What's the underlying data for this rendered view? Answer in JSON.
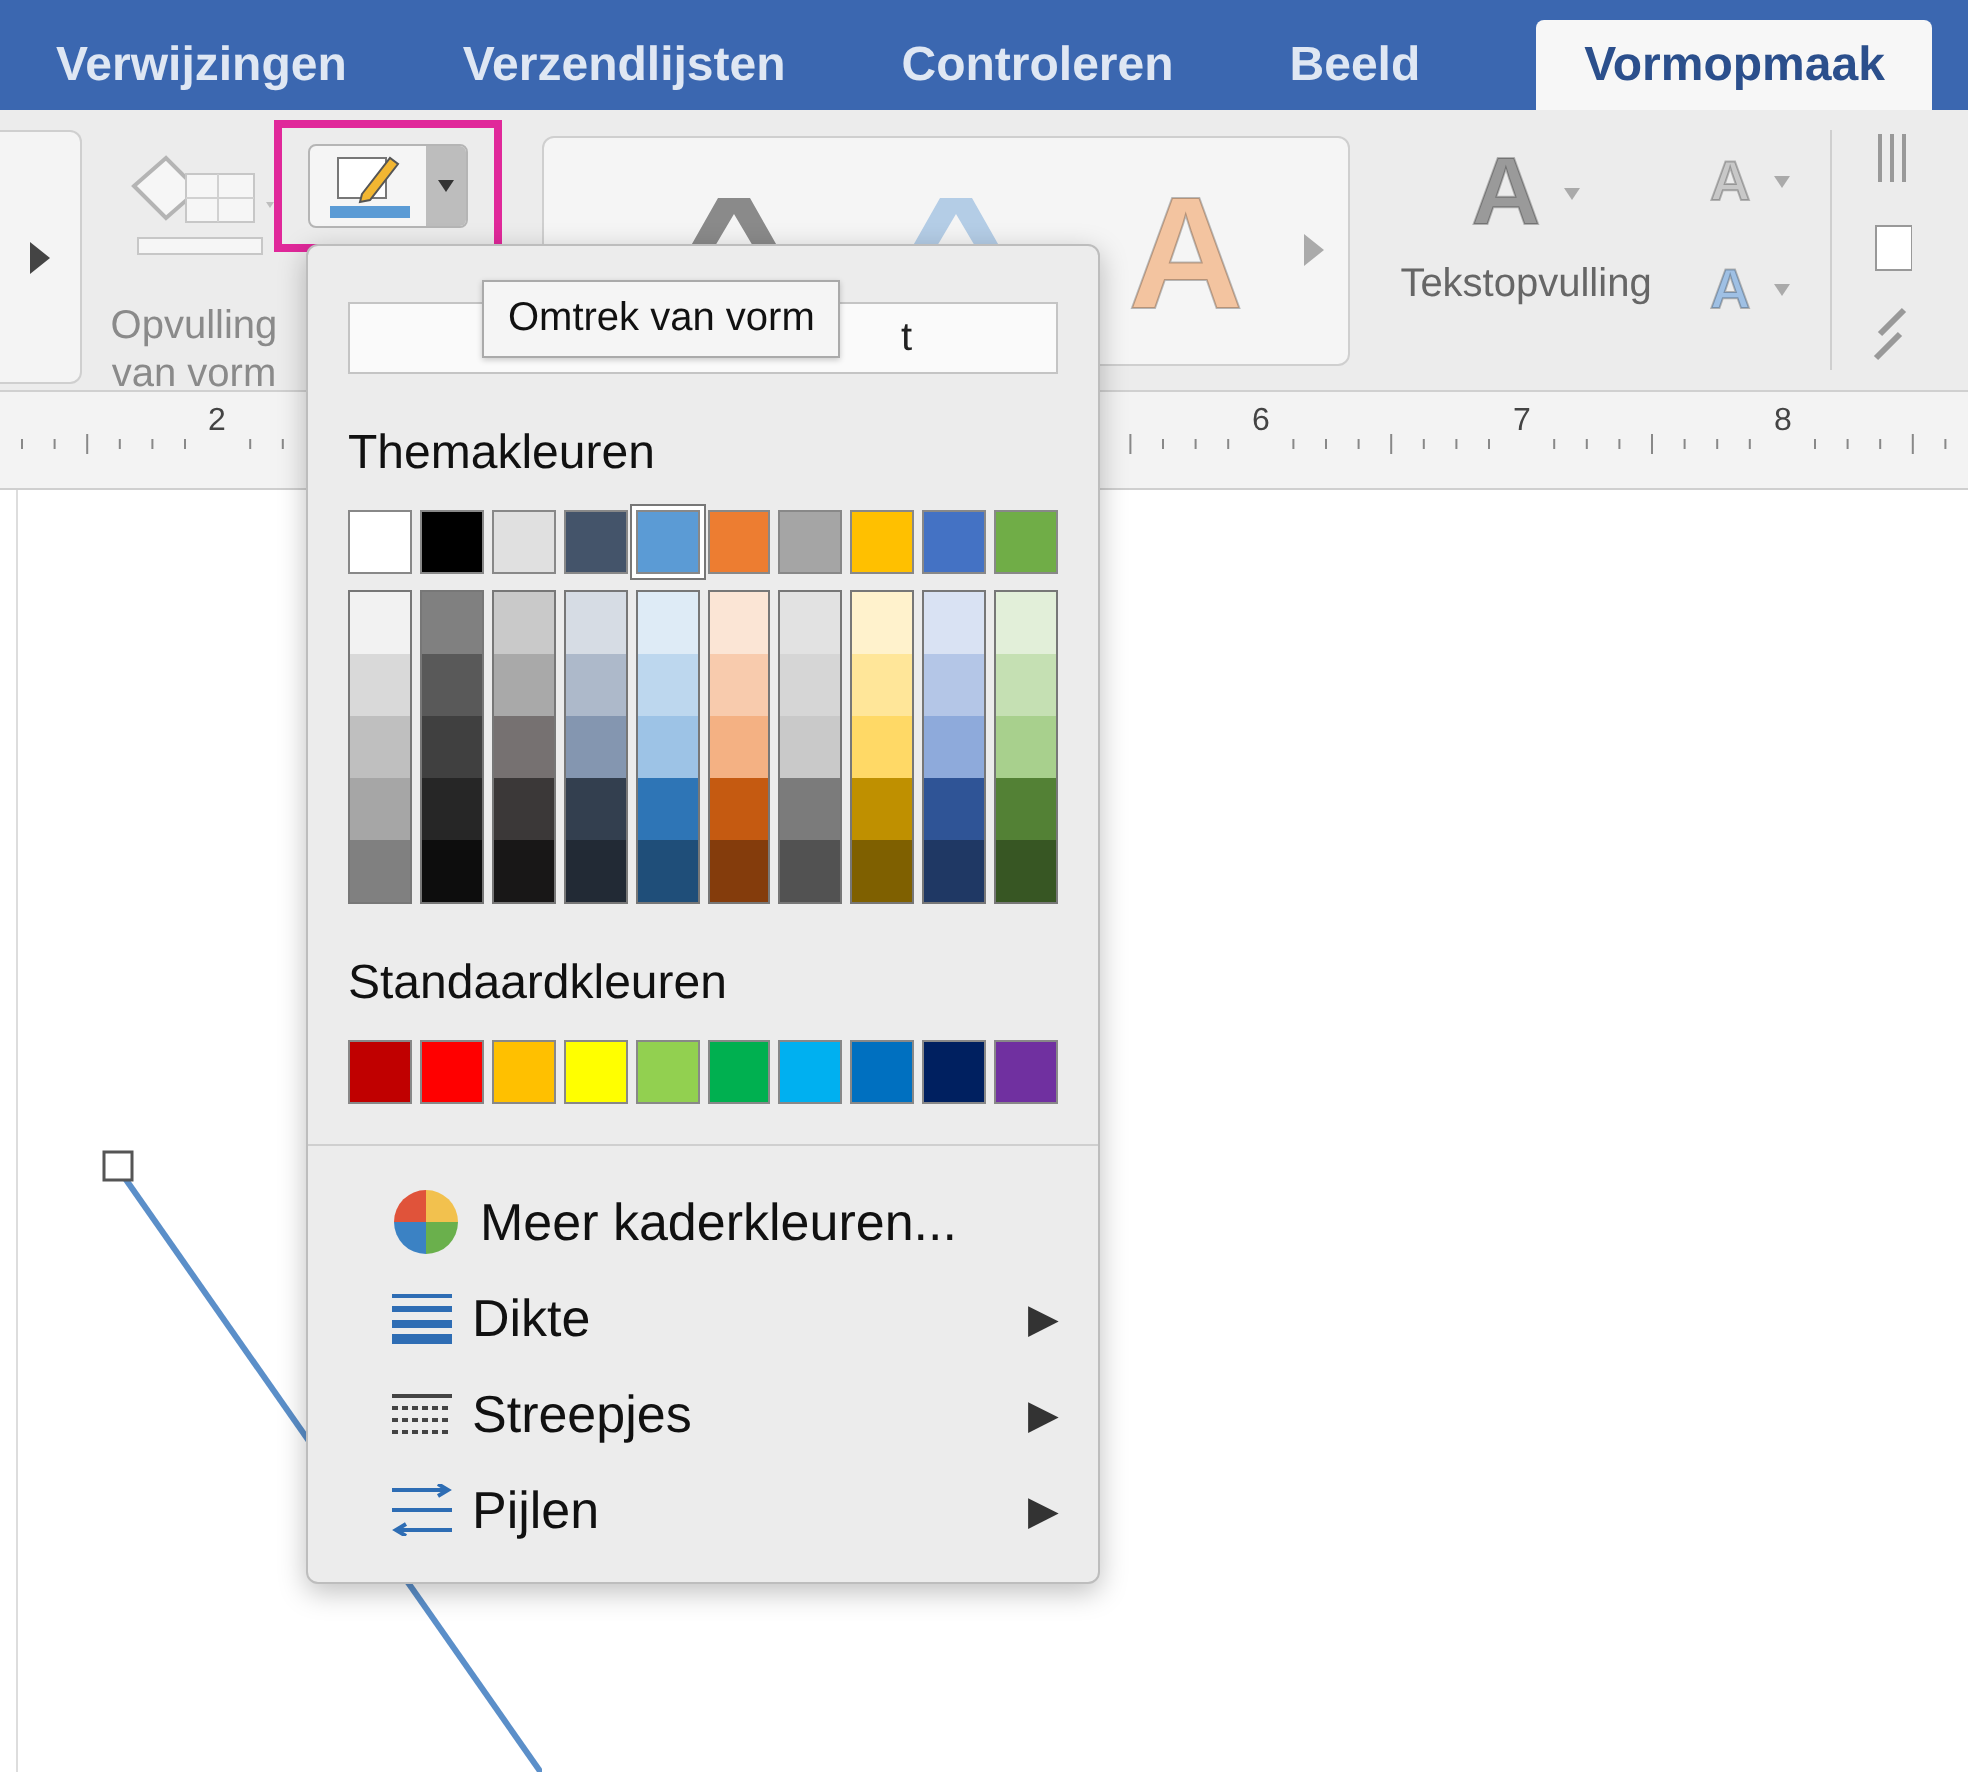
{
  "tabs": [
    {
      "label": "Verwijzingen",
      "selected": false
    },
    {
      "label": "Verzendlijsten",
      "selected": false
    },
    {
      "label": "Controleren",
      "selected": false
    },
    {
      "label": "Beeld",
      "selected": false
    },
    {
      "label": "Vormopmaak",
      "selected": true
    }
  ],
  "ribbon": {
    "fill_button": {
      "label": "Opvulling van vorm",
      "disabled": true
    },
    "outline_button": {
      "highlighted": true
    },
    "wordart_styles": [
      {
        "color": "#8a8a8a"
      },
      {
        "color": "#b4cde6"
      },
      {
        "glyph": "A",
        "color": "#f3c4a0"
      }
    ],
    "text_fill": {
      "glyph": "A",
      "label": "Tekstopvulling"
    },
    "text_outline": {
      "glyph": "A"
    },
    "text_effects": {
      "glyph": "A"
    }
  },
  "ruler": {
    "labels": [
      "2",
      "6",
      "7",
      "8"
    ]
  },
  "tooltip": "Omtrek van vorm",
  "menu": {
    "field_value": "t",
    "theme_heading": "Themakleuren",
    "theme_colors": [
      {
        "color": "#ffffff",
        "selected": false,
        "shades": [
          {
            "color": "#f2f2f2"
          },
          {
            "color": "#d9d9d9"
          },
          {
            "color": "#bfbfbf"
          },
          {
            "color": "#a6a6a6"
          },
          {
            "color": "#808080"
          }
        ]
      },
      {
        "color": "#000000",
        "selected": false,
        "shades": [
          {
            "color": "#808080"
          },
          {
            "color": "#595959"
          },
          {
            "color": "#404040"
          },
          {
            "color": "#262626"
          },
          {
            "color": "#0d0d0d"
          }
        ]
      },
      {
        "color": "#e0e0e0",
        "selected": false,
        "shades": [
          {
            "color": "#c9c9c9"
          },
          {
            "color": "#a9a9a9"
          },
          {
            "color": "#767171"
          },
          {
            "color": "#3b3838"
          },
          {
            "color": "#181717"
          }
        ]
      },
      {
        "color": "#44546a",
        "selected": false,
        "shades": [
          {
            "color": "#d6dce4"
          },
          {
            "color": "#adb9ca"
          },
          {
            "color": "#8496b0"
          },
          {
            "color": "#333f4f"
          },
          {
            "color": "#222a35"
          }
        ]
      },
      {
        "color": "#5b9bd5",
        "selected": true,
        "shades": [
          {
            "color": "#deebf6"
          },
          {
            "color": "#bdd7ee"
          },
          {
            "color": "#9dc3e6"
          },
          {
            "color": "#2e75b6"
          },
          {
            "color": "#1f4e79"
          }
        ]
      },
      {
        "color": "#ed7d31",
        "selected": false,
        "shades": [
          {
            "color": "#fbe5d5"
          },
          {
            "color": "#f8cbad"
          },
          {
            "color": "#f4b183"
          },
          {
            "color": "#c55a11"
          },
          {
            "color": "#843c0c"
          }
        ]
      },
      {
        "color": "#a5a5a5",
        "selected": false,
        "shades": [
          {
            "color": "#e2e2e2"
          },
          {
            "color": "#d6d6d6"
          },
          {
            "color": "#c9c9c9"
          },
          {
            "color": "#7b7b7b"
          },
          {
            "color": "#525252"
          }
        ]
      },
      {
        "color": "#ffc000",
        "selected": false,
        "shades": [
          {
            "color": "#fff2cc"
          },
          {
            "color": "#ffe699"
          },
          {
            "color": "#ffd966"
          },
          {
            "color": "#bf9000"
          },
          {
            "color": "#7f6000"
          }
        ]
      },
      {
        "color": "#4472c4",
        "selected": false,
        "shades": [
          {
            "color": "#d9e2f3"
          },
          {
            "color": "#b4c6e7"
          },
          {
            "color": "#8eaadb"
          },
          {
            "color": "#2f5496"
          },
          {
            "color": "#1f3864"
          }
        ]
      },
      {
        "color": "#70ad47",
        "selected": false,
        "shades": [
          {
            "color": "#e2efd9"
          },
          {
            "color": "#c5e0b3"
          },
          {
            "color": "#a8d08d"
          },
          {
            "color": "#538135"
          },
          {
            "color": "#375623"
          }
        ]
      }
    ],
    "standard_heading": "Standaardkleuren",
    "standard_colors": [
      {
        "color": "#c00000"
      },
      {
        "color": "#ff0000"
      },
      {
        "color": "#ffc000"
      },
      {
        "color": "#ffff00"
      },
      {
        "color": "#92d050"
      },
      {
        "color": "#00b050"
      },
      {
        "color": "#00b0f0"
      },
      {
        "color": "#0070c0"
      },
      {
        "color": "#002060"
      },
      {
        "color": "#7030a0"
      }
    ],
    "items": [
      {
        "kind": "colors",
        "label": "Meer kaderkleuren..."
      },
      {
        "kind": "weight",
        "label": "Dikte",
        "submenu": "▶"
      },
      {
        "kind": "dashes",
        "label": "Streepjes",
        "submenu": "▶"
      },
      {
        "kind": "arrows",
        "label": "Pijlen",
        "submenu": "▶"
      }
    ]
  }
}
